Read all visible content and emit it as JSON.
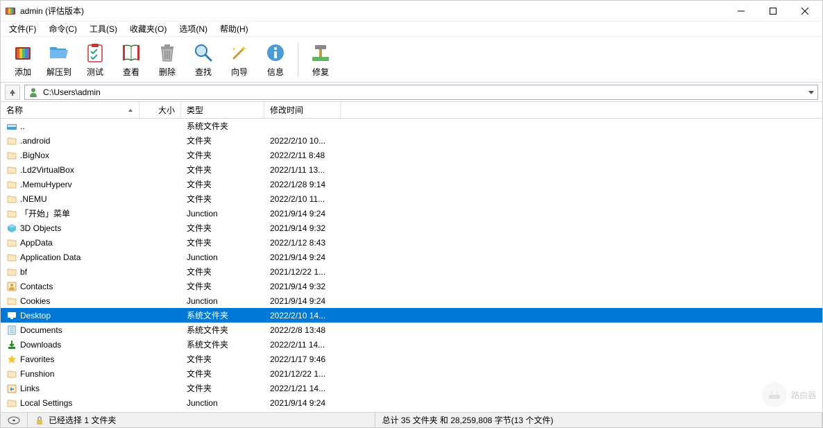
{
  "window": {
    "title": "admin (评估版本)"
  },
  "menu": [
    "文件(F)",
    "命令(C)",
    "工具(S)",
    "收藏夹(O)",
    "选项(N)",
    "帮助(H)"
  ],
  "toolbar": [
    {
      "id": "add",
      "label": "添加"
    },
    {
      "id": "extract",
      "label": "解压到"
    },
    {
      "id": "test",
      "label": "测试"
    },
    {
      "id": "view",
      "label": "查看"
    },
    {
      "id": "delete",
      "label": "删除"
    },
    {
      "id": "find",
      "label": "查找"
    },
    {
      "id": "wizard",
      "label": "向导"
    },
    {
      "id": "info",
      "label": "信息"
    },
    {
      "id": "repair",
      "label": "修复"
    }
  ],
  "path": "C:\\Users\\admin",
  "columns": {
    "name": "名称",
    "size": "大小",
    "type": "类型",
    "date": "修改时间"
  },
  "rows": [
    {
      "ic": "drive",
      "name": "..",
      "size": "",
      "type": "系统文件夹",
      "date": ""
    },
    {
      "ic": "folder",
      "name": ".android",
      "size": "",
      "type": "文件夹",
      "date": "2022/2/10 10..."
    },
    {
      "ic": "folder",
      "name": ".BigNox",
      "size": "",
      "type": "文件夹",
      "date": "2022/2/11 8:48"
    },
    {
      "ic": "folder",
      "name": ".Ld2VirtualBox",
      "size": "",
      "type": "文件夹",
      "date": "2022/1/11 13..."
    },
    {
      "ic": "folder",
      "name": ".MemuHyperv",
      "size": "",
      "type": "文件夹",
      "date": "2022/1/28 9:14"
    },
    {
      "ic": "folder",
      "name": ".NEMU",
      "size": "",
      "type": "文件夹",
      "date": "2022/2/10 11..."
    },
    {
      "ic": "folder",
      "name": "「开始」菜单",
      "size": "",
      "type": "Junction",
      "date": "2021/9/14 9:24"
    },
    {
      "ic": "3d",
      "name": "3D Objects",
      "size": "",
      "type": "文件夹",
      "date": "2021/9/14 9:32"
    },
    {
      "ic": "folder",
      "name": "AppData",
      "size": "",
      "type": "文件夹",
      "date": "2022/1/12 8:43"
    },
    {
      "ic": "folder",
      "name": "Application Data",
      "size": "",
      "type": "Junction",
      "date": "2021/9/14 9:24"
    },
    {
      "ic": "folder",
      "name": "bf",
      "size": "",
      "type": "文件夹",
      "date": "2021/12/22 1..."
    },
    {
      "ic": "contacts",
      "name": "Contacts",
      "size": "",
      "type": "文件夹",
      "date": "2021/9/14 9:32"
    },
    {
      "ic": "folder",
      "name": "Cookies",
      "size": "",
      "type": "Junction",
      "date": "2021/9/14 9:24"
    },
    {
      "ic": "desktop",
      "name": "Desktop",
      "size": "",
      "type": "系统文件夹",
      "date": "2022/2/10 14...",
      "selected": true
    },
    {
      "ic": "docs",
      "name": "Documents",
      "size": "",
      "type": "系统文件夹",
      "date": "2022/2/8 13:48"
    },
    {
      "ic": "downloads",
      "name": "Downloads",
      "size": "",
      "type": "系统文件夹",
      "date": "2022/2/11 14..."
    },
    {
      "ic": "fav",
      "name": "Favorites",
      "size": "",
      "type": "文件夹",
      "date": "2022/1/17 9:46"
    },
    {
      "ic": "folder",
      "name": "Funshion",
      "size": "",
      "type": "文件夹",
      "date": "2021/12/22 1..."
    },
    {
      "ic": "links",
      "name": "Links",
      "size": "",
      "type": "文件夹",
      "date": "2022/1/21 14..."
    },
    {
      "ic": "folder",
      "name": "Local Settings",
      "size": "",
      "type": "Junction",
      "date": "2021/9/14 9:24"
    }
  ],
  "status": {
    "selection": "已经选择 1 文件夹",
    "total": "总计 35 文件夹 和 28,259,808 字节(13 个文件)"
  },
  "watermark": "路由器"
}
